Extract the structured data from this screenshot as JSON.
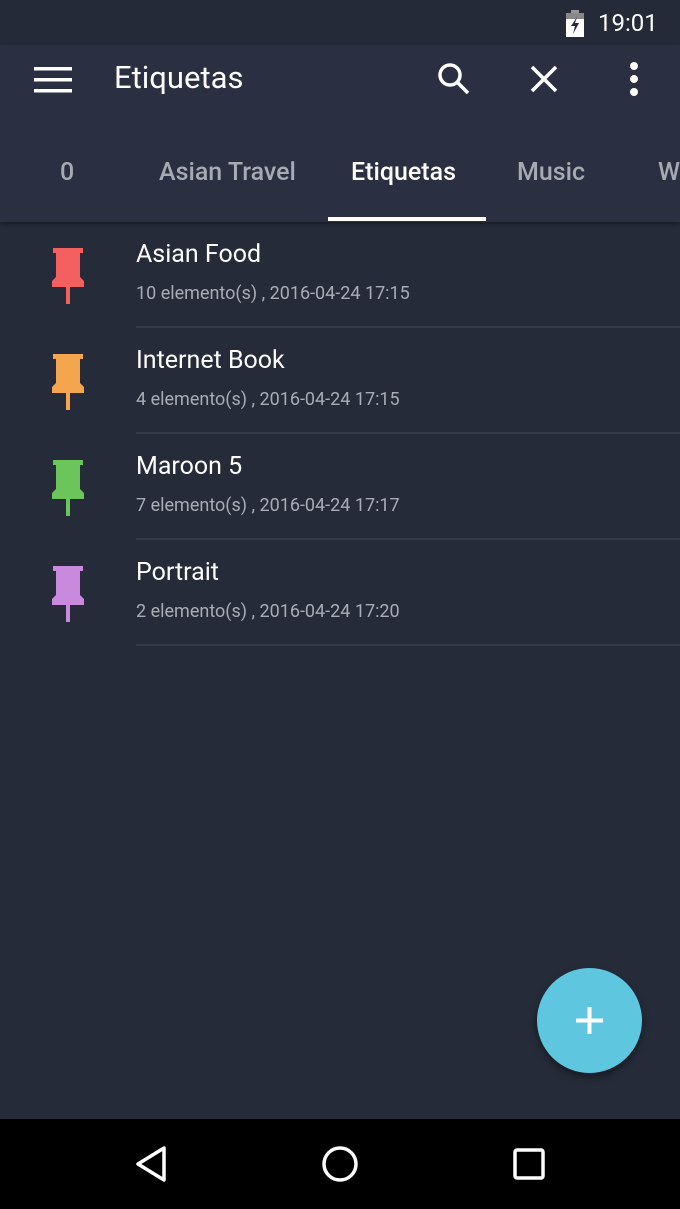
{
  "status_bar": {
    "time": "19:01",
    "battery_icon": "battery-charging-icon"
  },
  "app_bar": {
    "title": "Etiquetas",
    "icons": [
      "menu-icon",
      "search-icon",
      "close-icon",
      "more-vert-icon"
    ]
  },
  "tabs": [
    {
      "label": "0",
      "active": false
    },
    {
      "label": "Asian Travel",
      "active": false
    },
    {
      "label": "Etiquetas",
      "active": true
    },
    {
      "label": "Music",
      "active": false
    },
    {
      "label": "W",
      "active": false
    }
  ],
  "labels": [
    {
      "name": "Asian Food",
      "details": "10 elemento(s) , 2016-04-24 17:15",
      "color": "#f45f5f"
    },
    {
      "name": "Internet Book",
      "details": "4 elemento(s) , 2016-04-24 17:15",
      "color": "#f5a54e"
    },
    {
      "name": "Maroon 5",
      "details": "7 elemento(s) , 2016-04-24 17:17",
      "color": "#6cc55a"
    },
    {
      "name": "Portrait",
      "details": "2 elemento(s) , 2016-04-24 17:20",
      "color": "#c98ade"
    }
  ],
  "fab": {
    "icon": "plus-icon",
    "color": "#5fc6e0"
  },
  "nav_bar": {
    "icons": [
      "back-icon",
      "home-icon",
      "recents-icon"
    ]
  }
}
